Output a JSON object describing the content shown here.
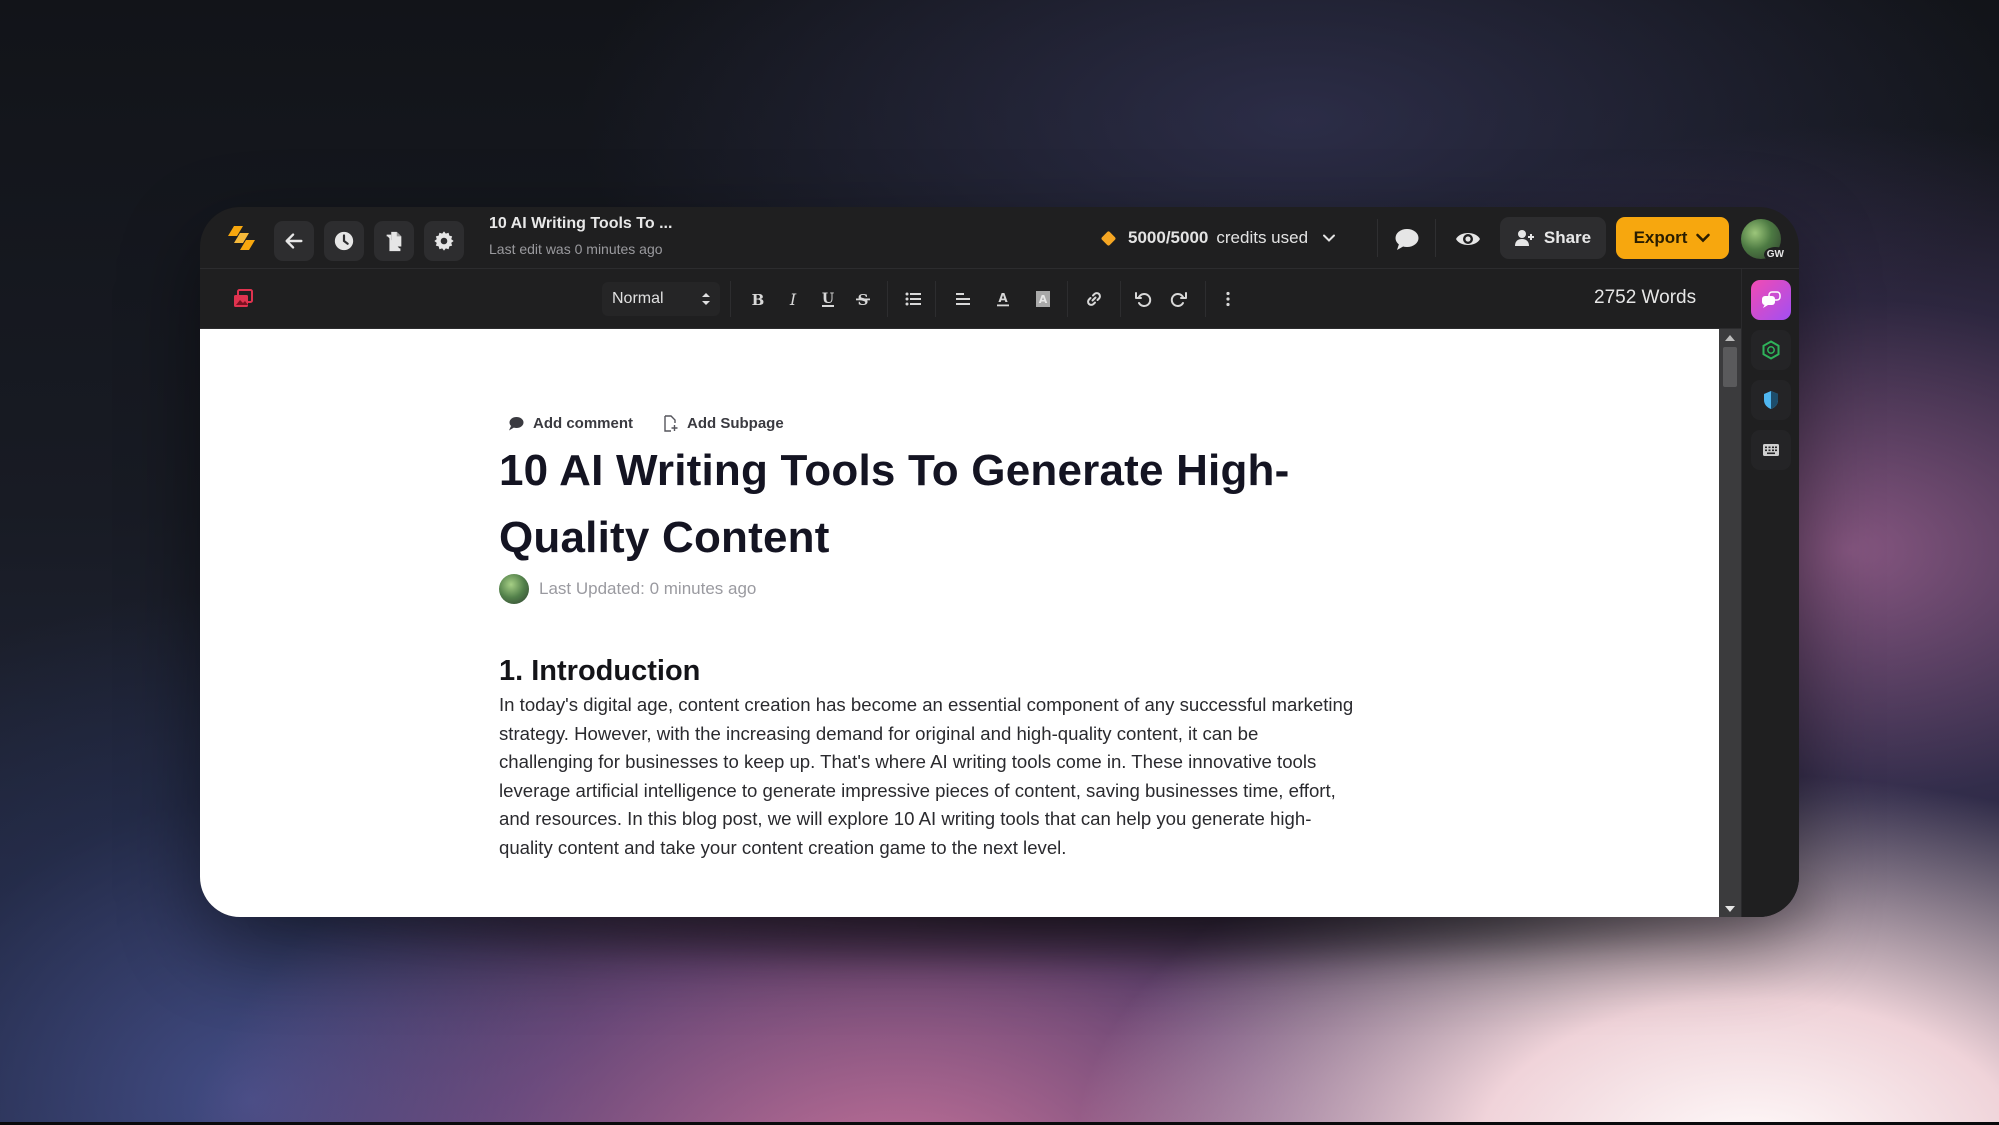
{
  "app": {
    "doc_title": "10 AI Writing Tools To ...",
    "last_edit": "Last edit was 0 minutes ago"
  },
  "topbar": {
    "icons": [
      "logo-icon",
      "back-arrow-icon",
      "history-clock-icon",
      "documents-icon",
      "settings-gear-icon"
    ],
    "credits_used": "5000/5000",
    "credits_label": "credits used",
    "share_label": "Share",
    "export_label": "Export",
    "avatar_initials": "GW"
  },
  "toolbar": {
    "style_value": "Normal",
    "buttons": [
      "bold",
      "italic",
      "underline",
      "strikethrough",
      "bullet-list",
      "align",
      "text-color",
      "highlight",
      "link",
      "undo",
      "redo",
      "more"
    ],
    "word_count": "2752 Words"
  },
  "rail": {
    "items": [
      "chat-assistant",
      "plagiarism-check",
      "shield",
      "keyboard-shortcuts"
    ]
  },
  "document": {
    "add_comment": "Add comment",
    "add_subpage": "Add Subpage",
    "title_line1": "10 AI Writing Tools To Generate High-",
    "title_line2": "Quality Content",
    "last_updated": "Last Updated: 0 minutes ago",
    "section_heading": "1. Introduction",
    "paragraph_lines": [
      "In today's digital age, content creation has become an essential component of any successful marketing",
      "strategy. However, with the increasing demand for original and high-quality content, it can be",
      "challenging for businesses to keep up. That's where AI writing tools come in. These innovative tools",
      "leverage artificial intelligence to generate impressive pieces of content, saving businesses time, effort,",
      "and resources. In this blog post, we will explore 10 AI writing tools that can help you generate high-",
      "quality content and take your content creation game to the next level."
    ]
  },
  "colors": {
    "accent_orange": "#f7a70e",
    "credit_diamond": "#f5a623",
    "gallery_icon_red": "#e0334f",
    "rail_active_gradient_start": "#f24bb3",
    "rail_active_gradient_end": "#a24ff2",
    "plagiarism_green": "#2fb35a",
    "shield_blue": "#4fb6f0"
  }
}
